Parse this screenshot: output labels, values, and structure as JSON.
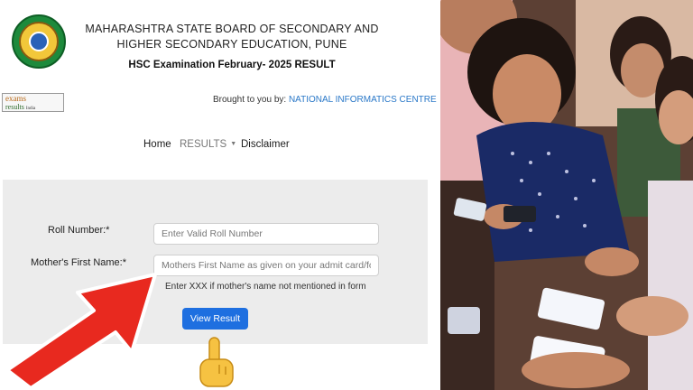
{
  "header": {
    "board_name_line1": "MAHARASHTRA STATE BOARD OF SECONDARY AND",
    "board_name_line2": "HIGHER SECONDARY EDUCATION, PUNE",
    "exam_title": "HSC Examination February- 2025 RESULT"
  },
  "partner_logo": {
    "line1": "exams",
    "line2": "results",
    "line3": "India"
  },
  "credits": {
    "prefix": "Brought to you by:",
    "org": "NATIONAL INFORMATICS CENTRE"
  },
  "nav": {
    "home": "Home",
    "results": "RESULTS",
    "disclaimer": "Disclaimer"
  },
  "form": {
    "roll_label": "Roll Number:*",
    "roll_placeholder": "Enter Valid Roll Number",
    "roll_value": "",
    "mother_label": "Mother's First Name:*",
    "mother_placeholder": "Mothers First Name as given on your admit card/form",
    "mother_value": "",
    "hint": "Enter XXX if mother's name not mentioned in form",
    "submit": "View Result"
  },
  "colors": {
    "link_blue": "#2a78c8",
    "button_blue": "#1e6fe0",
    "arrow_red": "#e8291f",
    "panel_gray": "#ececec"
  },
  "icons": {
    "board_logo": "board-emblem-icon",
    "arrow": "red-arrow-icon",
    "hand": "pointing-hand-icon",
    "caret": "caret-down-icon"
  }
}
